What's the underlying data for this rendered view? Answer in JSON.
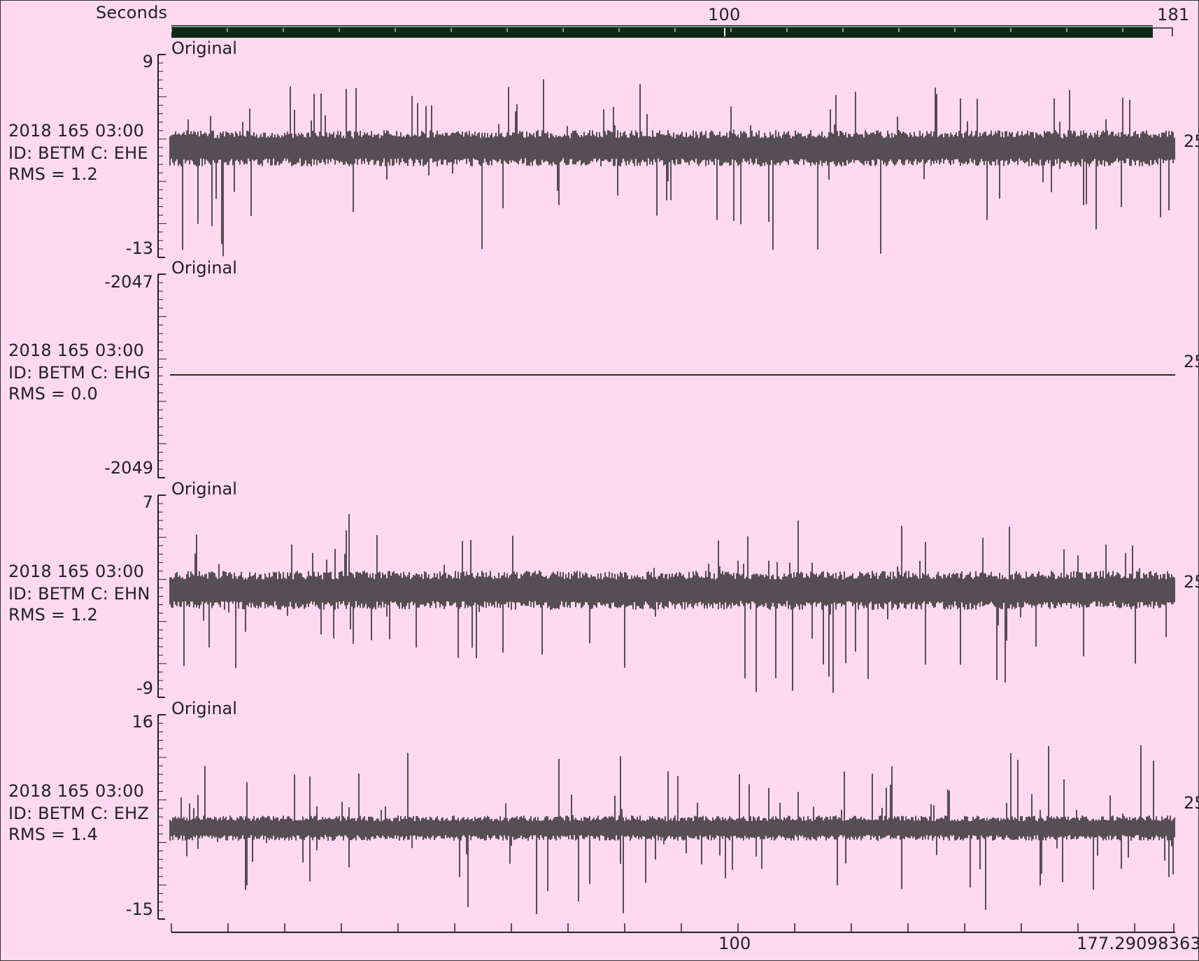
{
  "time_axis": {
    "top_label": "Seconds",
    "top_tick_major": "100",
    "top_end": "181",
    "bottom_tick_major": "100",
    "bottom_end": "177.29098363"
  },
  "channels": [
    {
      "label": "Original",
      "y_max": "9",
      "y_min": "-13",
      "time": "2018 165 03:00",
      "id_line": "ID: BETM C: EHE",
      "rms": "RMS = 1.2",
      "side": "25"
    },
    {
      "label": "Original",
      "y_max": "-2047",
      "y_min": "-2049",
      "time": "2018 165 03:00",
      "id_line": "ID: BETM C: EHG",
      "rms": "RMS = 0.0",
      "side": "25"
    },
    {
      "label": "Original",
      "y_max": "7",
      "y_min": "-9",
      "time": "2018 165 03:00",
      "id_line": "ID: BETM C: EHN",
      "rms": "RMS = 1.2",
      "side": "25"
    },
    {
      "label": "Original",
      "y_max": "16",
      "y_min": "-15",
      "time": "2018 165 03:00",
      "id_line": "ID: BETM C: EHZ",
      "rms": "RMS = 1.4",
      "side": "25"
    }
  ],
  "colors": {
    "background": "#ffd9f0",
    "trace": "#2b2b2b",
    "scrollbar": "#0d2a14"
  }
}
